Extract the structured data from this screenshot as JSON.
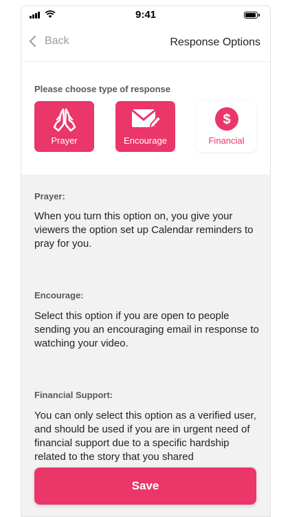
{
  "status_bar": {
    "time": "9:41"
  },
  "nav": {
    "back_label": "Back",
    "title": "Response Options"
  },
  "choose": {
    "label": "Please choose type of response",
    "options": [
      {
        "label": "Prayer",
        "icon": "praying-hands-icon",
        "selected": true
      },
      {
        "label": "Encourage",
        "icon": "envelope-pencil-icon",
        "selected": true
      },
      {
        "label": "Financial",
        "icon": "dollar-icon",
        "selected": false
      }
    ]
  },
  "descriptions": [
    {
      "heading": "Prayer:",
      "text": "When you turn this option on, you give your viewers the option set up Calendar reminders to pray for you."
    },
    {
      "heading": "Encourage:",
      "text": "Select this option if you are open to people sending you an encouraging email in response to watching your video."
    },
    {
      "heading": "Financial Support:",
      "text": "You can only select this option as a verified user, and should be used if you are in urgent need of financial support due to a specific hardship related to the story that you shared"
    }
  ],
  "save_label": "Save",
  "colors": {
    "accent": "#ea3669",
    "muted_text": "#555a63",
    "section_bg": "#f2f2f2"
  }
}
